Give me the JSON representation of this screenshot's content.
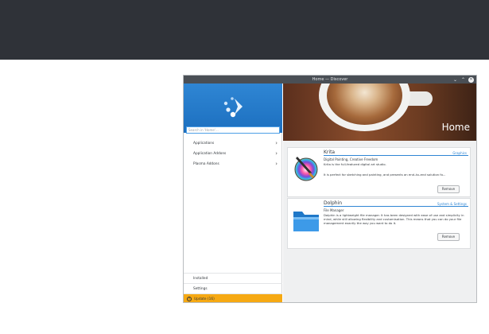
{
  "window": {
    "title": "Home — Discover",
    "controls": {
      "minimize": "⌄",
      "maximize": "⌃",
      "close": "✕"
    }
  },
  "sidebar": {
    "search_placeholder": "Search in 'Home'...",
    "items": [
      {
        "label": "Applications",
        "icon": "chevron-right-icon"
      },
      {
        "label": "Application Addons",
        "icon": "chevron-right-icon"
      },
      {
        "label": "Plasma Addons",
        "icon": "chevron-right-icon"
      }
    ],
    "bottom": {
      "installed": "Installed",
      "settings": "Settings",
      "update": "Update (16)"
    }
  },
  "main": {
    "hero_title": "Home",
    "apps": [
      {
        "name": "Krita",
        "category": "Graphics",
        "subtitle": "Digital Painting, Creative Freedom",
        "description": "Krita is the full-featured digital art studio.",
        "description2": "It is perfect for sketching and painting, and presents an end–to–end solution fo...",
        "button": "Remove",
        "icon": "krita-icon"
      },
      {
        "name": "Dolphin",
        "category": "System & Settings",
        "subtitle": "File Manager",
        "description": "Dolphin is a lightweight file manager. It has been designed with ease of use and simplicity in mind, while still allowing flexibility and customisation. This means that you can do your file management exactly the way you want to do it.",
        "button": "Remove",
        "icon": "dolphin-folder-icon"
      }
    ]
  },
  "colors": {
    "accent": "#2f86d4",
    "update_bar": "#f6a913",
    "topbar": "#2f3238"
  }
}
